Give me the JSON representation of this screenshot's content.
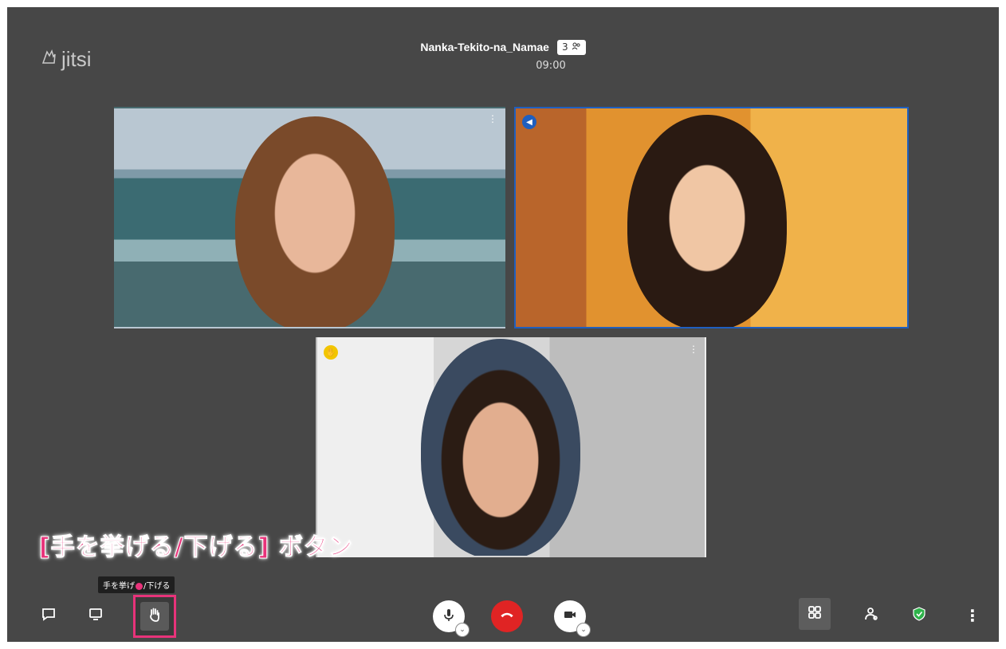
{
  "app": {
    "logo_text": "jitsi",
    "logo_icon": "jitsi-hand-icon"
  },
  "meeting": {
    "title": "Nanka-Tekito-na_Namae",
    "participant_count": "3",
    "participant_icon": "participants-icon",
    "timer": "09:00"
  },
  "tiles": [
    {
      "badge_icon": "",
      "menu": "⋮",
      "active": false
    },
    {
      "badge_icon": "dominant-speaker-icon",
      "badge_color": "#1f5fbf",
      "menu": "",
      "active": true
    },
    {
      "badge_icon": "raised-hand-badge-icon",
      "badge_color": "#f2c500",
      "menu": "⋮",
      "active": false
    }
  ],
  "annotation": {
    "text": "[手を挙げる/下げる] ボタン",
    "color": "#e8337a"
  },
  "tooltip": {
    "text_before": "手を挙げ",
    "text_after": "/下げる"
  },
  "toolbar": {
    "left": [
      {
        "name": "chat-button",
        "icon": "chat-icon"
      },
      {
        "name": "screen-share-button",
        "icon": "desktop-icon"
      },
      {
        "name": "raise-hand-button",
        "icon": "raised-hand-icon"
      }
    ],
    "center": [
      {
        "name": "microphone-button",
        "icon": "microphone-icon"
      },
      {
        "name": "hangup-button",
        "icon": "hangup-icon"
      },
      {
        "name": "camera-button",
        "icon": "camera-icon"
      }
    ],
    "right": [
      {
        "name": "tile-view-button",
        "icon": "tile-view-icon"
      },
      {
        "name": "invite-button",
        "icon": "invite-people-icon"
      },
      {
        "name": "security-button",
        "icon": "shield-icon",
        "color": "#2eb34a"
      },
      {
        "name": "more-options-button",
        "icon": "more-vertical-icon",
        "label": "⋮"
      }
    ]
  }
}
